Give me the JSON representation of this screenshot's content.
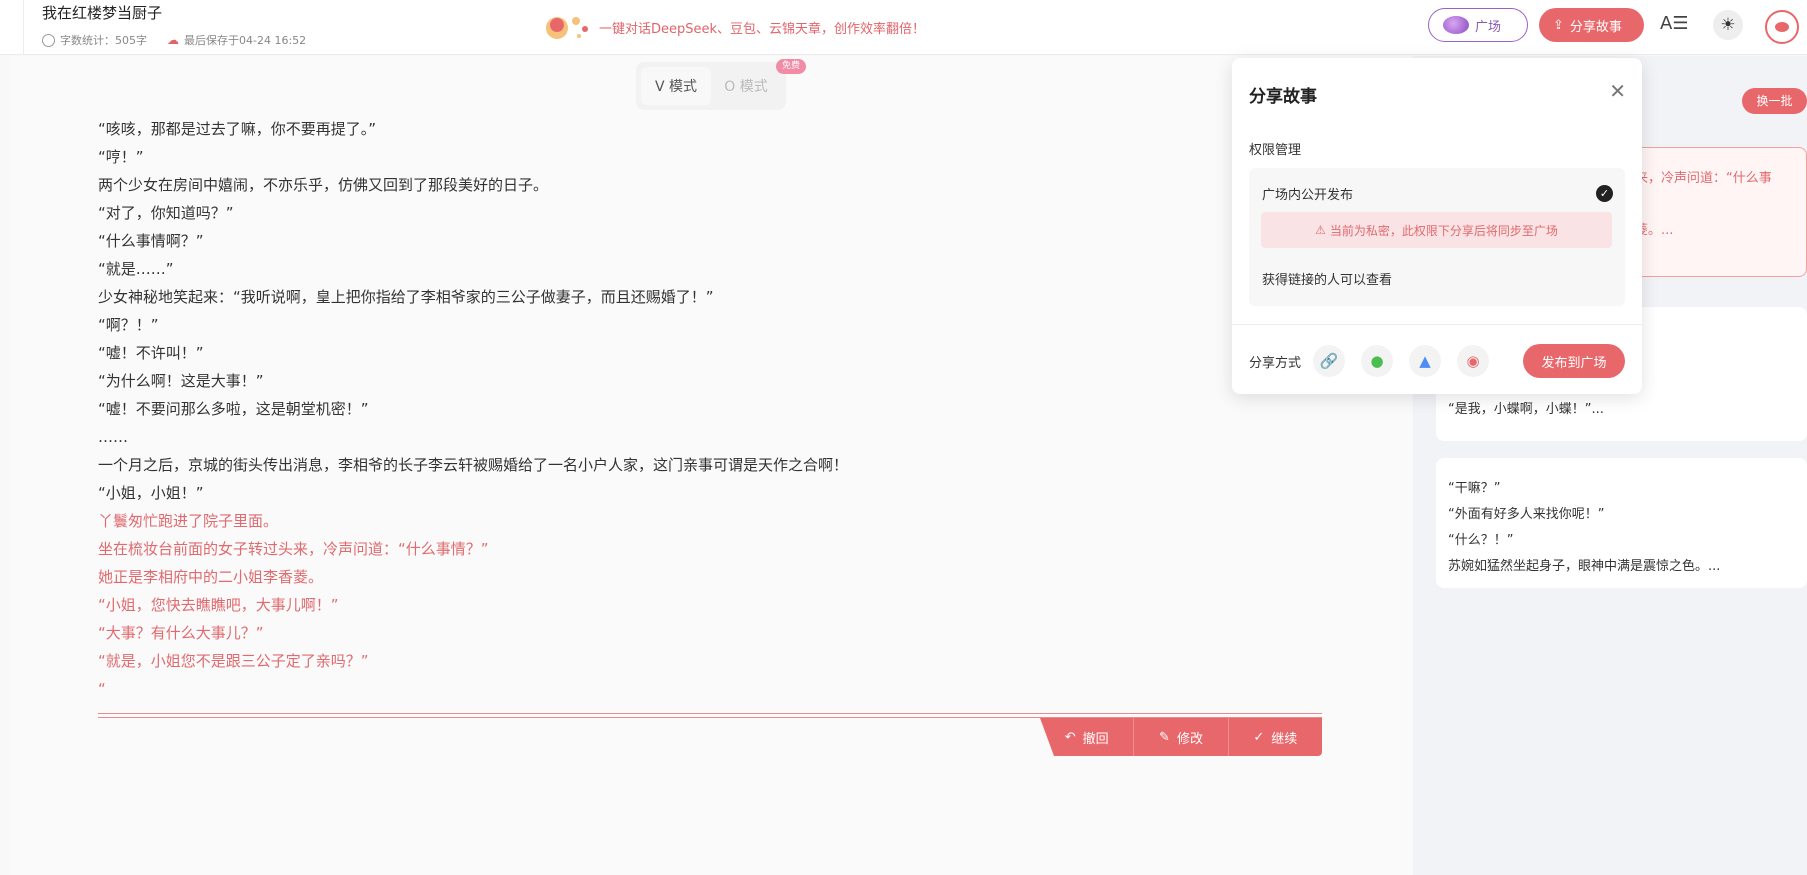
{
  "header": {
    "doc_title": "我在红楼梦当厨子",
    "word_count": "字数统计：505字",
    "saved_at": "最后保存于04-24 16:52",
    "promo_text": "一键对话DeepSeek、豆包、云锦天章，创作效率翻倍！",
    "plaza_label": "广场",
    "share_label": "分享故事"
  },
  "mode_toggle": {
    "v_label": "V 模式",
    "o_label": "O 模式",
    "free_badge": "免费"
  },
  "story": {
    "lines": [
      "“咳咳，那都是过去了嘛，你不要再提了。”",
      "“哼！”",
      "两个少女在房间中嬉闹，不亦乐乎，仿佛又回到了那段美好的日子。",
      "“对了，你知道吗？”",
      "“什么事情啊？”",
      "“就是……”",
      "少女神秘地笑起来：“我听说啊，皇上把你指给了李相爷家的三公子做妻子，而且还赐婚了！”",
      "“啊？！”",
      "“嘘！不许叫！”",
      "“为什么啊！这是大事！”",
      "“嘘！不要问那么多啦，这是朝堂机密！”",
      "……",
      "一个月之后，京城的街头传出消息，李相爷的长子李云轩被赐婚给了一名小户人家，这门亲事可谓是天作之合啊！",
      "“小姐，小姐！”"
    ],
    "new_lines": [
      "丫鬟匆忙跑进了院子里面。",
      "坐在梳妆台前面的女子转过头来，冷声问道：“什么事情？”",
      "她正是李相府中的二小姐李香菱。",
      "“小姐，您快去瞧瞧吧，大事儿啊！”",
      "“大事？有什么大事儿？”",
      "“就是，小姐您不是跟三公子定了亲吗？”",
      "“"
    ],
    "actions": {
      "undo": "撤回",
      "edit": "修改",
      "continue": "继续"
    }
  },
  "right_panel": {
    "refresh": "换一批",
    "card1_lines": [
      "来，冷声问道：“什么事",
      "",
      "菱。..."
    ],
    "card2_lines": [
      "“是我，小蝶啊，小蝶！”..."
    ],
    "card3_lines": [
      "“干嘛？”",
      "“外面有好多人来找你呢！”",
      "“什么？！”",
      "苏婉如猛然坐起身子，眼神中满是震惊之色。..."
    ]
  },
  "share_modal": {
    "title": "分享故事",
    "perm_label": "权限管理",
    "public_option": "广场内公开发布",
    "warning": "当前为私密，此权限下分享后将同步至广场",
    "link_option": "获得链接的人可以查看",
    "share_method": "分享方式",
    "publish": "发布到广场"
  },
  "colors": {
    "accent": "#e8676b",
    "plaza_purple": "#9a62c6"
  }
}
